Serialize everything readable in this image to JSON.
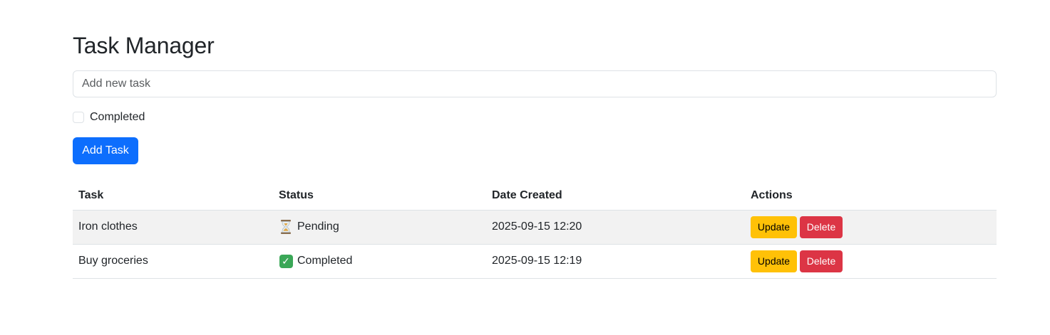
{
  "header": {
    "title": "Task Manager"
  },
  "form": {
    "placeholder": "Add new task",
    "value": "",
    "completed_label": "Completed",
    "completed_checked": false,
    "add_button_label": "Add Task"
  },
  "table": {
    "headers": [
      "Task",
      "Status",
      "Date Created",
      "Actions"
    ],
    "rows": [
      {
        "task": "Iron clothes",
        "status": "Pending",
        "status_icon": "hourglass-icon",
        "date": "2025-09-15 12:20",
        "update_label": "Update",
        "delete_label": "Delete"
      },
      {
        "task": "Buy groceries",
        "status": "Completed",
        "status_icon": "check-mark-icon",
        "date": "2025-09-15 12:19",
        "update_label": "Update",
        "delete_label": "Delete"
      }
    ]
  },
  "colors": {
    "primary": "#0d6efd",
    "warning": "#ffc107",
    "danger": "#dc3545",
    "success": "#3aa757",
    "stripe": "#f2f2f2"
  }
}
